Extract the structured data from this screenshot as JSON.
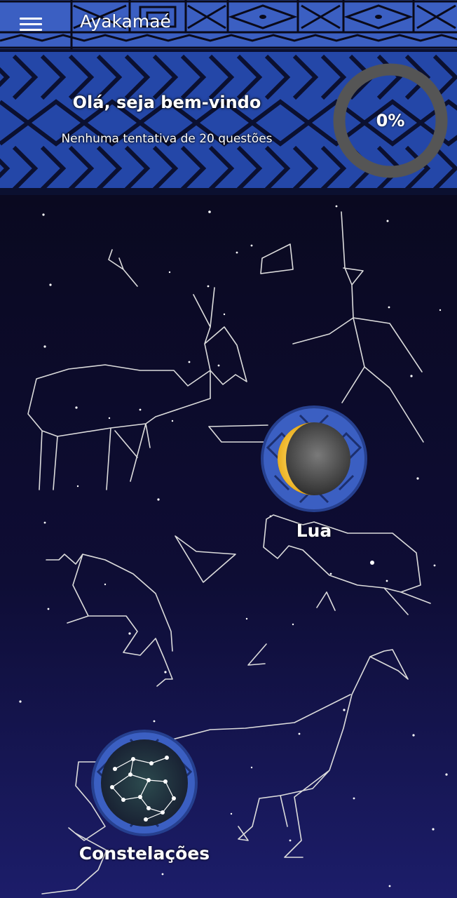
{
  "appbar": {
    "title": "Ayakamaé",
    "menu_icon": "menu-icon"
  },
  "banner": {
    "greeting": "Olá, seja bem-vindo",
    "subtitle": "Nenhuma tentativa de 20 questões",
    "progress_label": "0%",
    "progress_value": 0
  },
  "topics": [
    {
      "label": "Lua",
      "icon": "moon-icon"
    },
    {
      "label": "Constelações",
      "icon": "constellation-icon"
    }
  ],
  "colors": {
    "appbar_blue": "#3b5fc2",
    "banner_blue": "#1a3a8c",
    "sky_top": "#0a0920",
    "sky_bottom": "#1c1d6a",
    "ring_gray": "#555555"
  }
}
